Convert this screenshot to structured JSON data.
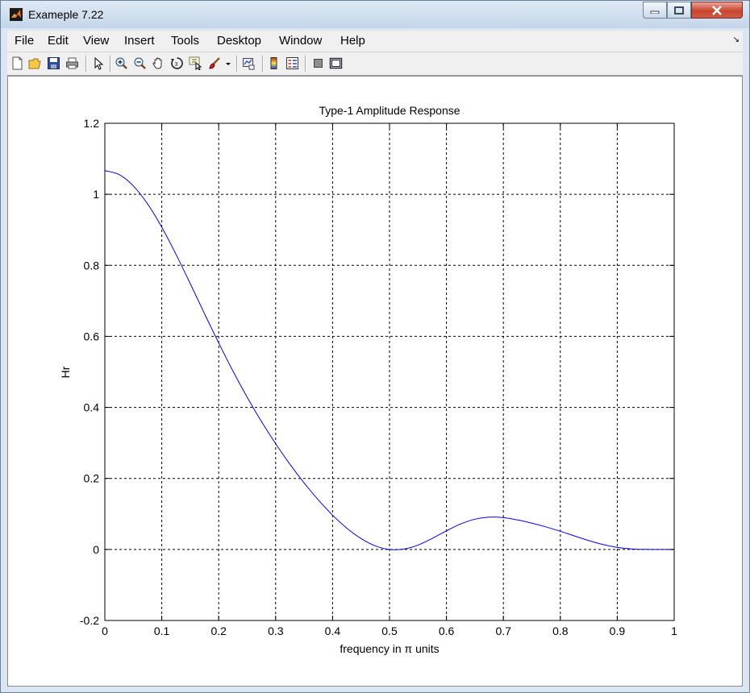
{
  "window": {
    "title": "Exameple 7.22",
    "app_icon": "matlab-icon",
    "controls": [
      "minimize-icon",
      "maximize-icon",
      "close-icon"
    ]
  },
  "menu": {
    "items": [
      "File",
      "Edit",
      "View",
      "Insert",
      "Tools",
      "Desktop",
      "Window",
      "Help"
    ],
    "dock_glyph": "↘"
  },
  "toolbar": {
    "tools": [
      "new-figure-icon",
      "open-file-icon",
      "save-icon",
      "print-icon",
      "pointer-icon",
      "zoom-in-icon",
      "zoom-out-icon",
      "pan-hand-icon",
      "rotate-3d-icon",
      "data-cursor-icon",
      "brush-icon",
      "brush-dropdown-icon",
      "link-plot-icon",
      "insert-colorbar-icon",
      "insert-legend-icon",
      "hide-plot-tools-icon",
      "show-plot-tools-icon"
    ]
  },
  "colors": {
    "line": "#0000ff",
    "close_button": "#c9442e"
  },
  "chart_data": {
    "type": "line",
    "title": "Type-1 Amplitude Response",
    "xlabel": "frequency in π units",
    "ylabel": "Hr",
    "xlim": [
      0,
      1
    ],
    "ylim": [
      -0.2,
      1.2
    ],
    "xticks": [
      "0",
      "0.1",
      "0.2",
      "0.3",
      "0.4",
      "0.5",
      "0.6",
      "0.7",
      "0.8",
      "0.9",
      "1"
    ],
    "yticks": [
      "-0.2",
      "0",
      "0.2",
      "0.4",
      "0.6",
      "0.8",
      "1",
      "1.2"
    ],
    "grid": true,
    "series": [
      {
        "x": [
          0,
          0.025,
          0.05,
          0.075,
          0.1,
          0.125,
          0.15,
          0.175,
          0.2,
          0.225,
          0.25,
          0.275,
          0.3,
          0.325,
          0.35,
          0.375,
          0.4,
          0.425,
          0.45,
          0.475,
          0.5,
          0.525,
          0.55,
          0.575,
          0.6,
          0.625,
          0.65,
          0.675,
          0.7,
          0.725,
          0.75,
          0.775,
          0.8,
          0.825,
          0.85,
          0.875,
          0.9,
          0.925,
          0.95,
          0.975,
          1
        ],
        "y": [
          1.0667,
          1.0557,
          1.0237,
          0.973,
          0.9073,
          0.8309,
          0.7485,
          0.6641,
          0.5813,
          0.5023,
          0.4286,
          0.3604,
          0.2977,
          0.2401,
          0.1874,
          0.1393,
          0.0965,
          0.0599,
          0.0307,
          0.0101,
          0.0,
          0.001,
          0.0123,
          0.031,
          0.0525,
          0.0718,
          0.0852,
          0.0909,
          0.0895,
          0.083,
          0.074,
          0.0634,
          0.0512,
          0.038,
          0.025,
          0.0139,
          0.0059,
          0.0015,
          0.0001,
          0.0,
          0.0
        ]
      }
    ]
  }
}
